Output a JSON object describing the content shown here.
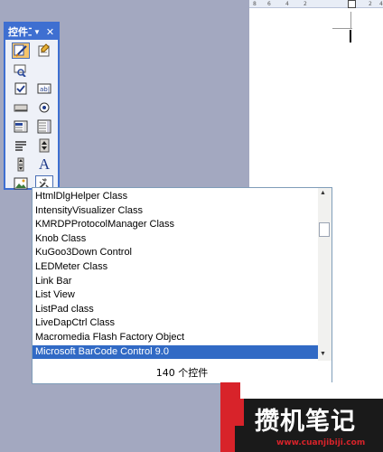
{
  "toolbox": {
    "title": "控件工具箱",
    "buttons": [
      {
        "icon": "design-mode-icon"
      },
      {
        "icon": "properties-icon"
      },
      {
        "icon": "view-code-icon"
      },
      {
        "icon": "spacer"
      },
      {
        "icon": "checkbox-icon"
      },
      {
        "icon": "textbox-icon"
      },
      {
        "icon": "command-button-icon"
      },
      {
        "icon": "option-button-icon"
      },
      {
        "icon": "listbox-icon"
      },
      {
        "icon": "combobox-icon"
      },
      {
        "icon": "toggle-button-icon"
      },
      {
        "icon": "spin-button-icon"
      },
      {
        "icon": "scrollbar-icon"
      },
      {
        "icon": "label-icon",
        "text": "A"
      },
      {
        "icon": "image-icon"
      },
      {
        "icon": "more-controls-icon"
      }
    ]
  },
  "ruler": {
    "ticks": [
      "8",
      "6",
      "4",
      "2",
      "2",
      "4"
    ]
  },
  "control_list": {
    "items": [
      "HtmlDlgHelper Class",
      "IntensityVisualizer Class",
      "KMRDPProtocolManager  Class",
      "Knob Class",
      "KuGoo3Down Control",
      "LEDMeter Class",
      "Link Bar",
      "List View",
      "ListPad class",
      "LiveDapCtrl Class",
      "Macromedia Flash Factory Object",
      "Microsoft BarCode Control 9.0"
    ],
    "selected_index": 11,
    "status": "140 个控件"
  },
  "watermark": {
    "text": "攒机笔记",
    "url": "www.cuanjibiji.com"
  },
  "colors": {
    "titlebar": "#3e6fd1",
    "selection": "#316ac5",
    "accent_red": "#d8232a"
  }
}
